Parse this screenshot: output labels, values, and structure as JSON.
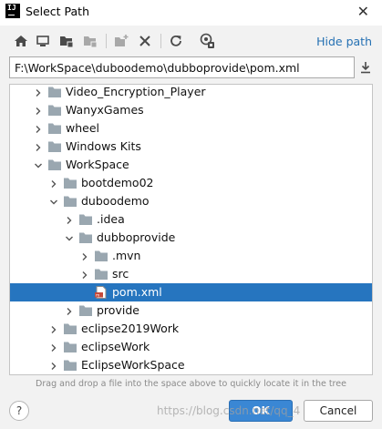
{
  "window": {
    "title": "Select Path",
    "app_icon_text": "IJ"
  },
  "toolbar": {
    "icons": [
      "home-icon",
      "desktop-icon",
      "project-folder-icon",
      "module-folder-icon",
      "new-folder-icon",
      "delete-icon",
      "refresh-icon",
      "show-hidden-icon"
    ],
    "hide_path_label": "Hide path"
  },
  "path": {
    "value": "F:\\WorkSpace\\duboodemo\\dubboprovide\\pom.xml"
  },
  "tree": {
    "items": [
      {
        "label": "Video_Encryption_Player",
        "level": 0,
        "expanded": false,
        "type": "folder"
      },
      {
        "label": "WanyxGames",
        "level": 0,
        "expanded": false,
        "type": "folder"
      },
      {
        "label": "wheel",
        "level": 0,
        "expanded": false,
        "type": "folder"
      },
      {
        "label": "Windows Kits",
        "level": 0,
        "expanded": false,
        "type": "folder"
      },
      {
        "label": "WorkSpace",
        "level": 0,
        "expanded": true,
        "type": "folder"
      },
      {
        "label": "bootdemo02",
        "level": 1,
        "expanded": false,
        "type": "folder"
      },
      {
        "label": "duboodemo",
        "level": 1,
        "expanded": true,
        "type": "folder"
      },
      {
        "label": ".idea",
        "level": 2,
        "expanded": false,
        "type": "folder"
      },
      {
        "label": "dubboprovide",
        "level": 2,
        "expanded": true,
        "type": "folder"
      },
      {
        "label": ".mvn",
        "level": 3,
        "expanded": false,
        "type": "folder"
      },
      {
        "label": "src",
        "level": 3,
        "expanded": false,
        "type": "folder"
      },
      {
        "label": "pom.xml",
        "level": 3,
        "expanded": null,
        "type": "maven-file",
        "selected": true
      },
      {
        "label": "provide",
        "level": 2,
        "expanded": false,
        "type": "folder"
      },
      {
        "label": "eclipse2019Work",
        "level": 1,
        "expanded": false,
        "type": "folder"
      },
      {
        "label": "eclipseWork",
        "level": 1,
        "expanded": false,
        "type": "folder"
      },
      {
        "label": "EclipseWorkSpace",
        "level": 1,
        "expanded": false,
        "type": "folder"
      }
    ]
  },
  "hint": "Drag and drop a file into the space above to quickly locate it in the tree",
  "footer": {
    "help_label": "?",
    "ok_label": "OK",
    "cancel_label": "Cancel"
  },
  "watermark": "https://blog.csdn.net/qq_4",
  "colors": {
    "selection": "#2675bf",
    "link": "#2470b3",
    "folder": "#9aa7b0",
    "ok_button": "#3a87d4"
  }
}
